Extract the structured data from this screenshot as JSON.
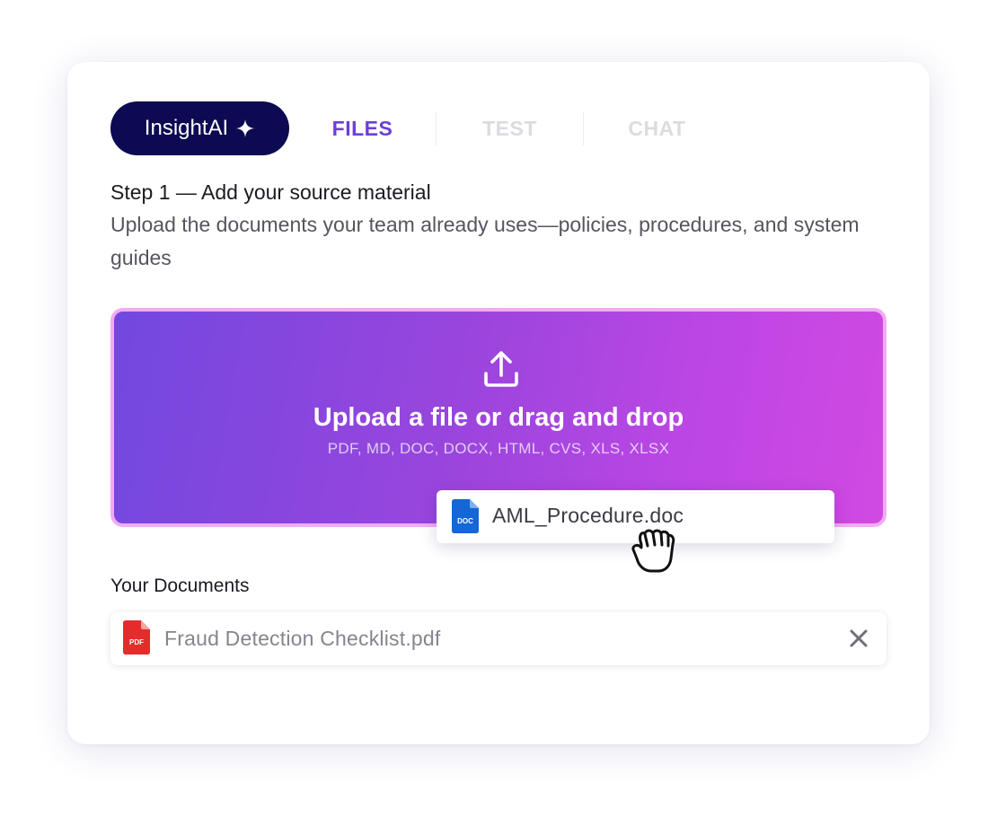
{
  "tabs": {
    "brand_label": "InsightAI",
    "brand_icon": "sparkle-icon",
    "items": [
      {
        "label": "FILES",
        "active": true
      },
      {
        "label": "TEST",
        "active": false
      },
      {
        "label": "CHAT",
        "active": false
      }
    ]
  },
  "step": {
    "title": "Step 1 — Add your source material",
    "description": "Upload the documents your team already uses—policies, procedures, and system guides"
  },
  "upload": {
    "icon": "upload-icon",
    "title": "Upload a file or drag and drop",
    "formats": "PDF, MD, DOC, DOCX, HTML, CVS, XLS, XLSX"
  },
  "dragging_file": {
    "name": "AML_Procedure.doc",
    "type_badge": "DOC",
    "icon": "doc-file-icon",
    "cursor_icon": "grab-hand-icon"
  },
  "documents": {
    "label": "Your Documents",
    "items": [
      {
        "name": "Fraud Detection Checklist.pdf",
        "type_badge": "PDF",
        "icon": "pdf-file-icon",
        "remove_icon": "close-icon"
      }
    ]
  },
  "colors": {
    "brand_navy": "#0c0a52",
    "active_tab": "#6c3fd8",
    "inactive_tab": "#dcdbe1",
    "dropzone_start": "#7248df",
    "dropzone_end": "#d149e3",
    "dropzone_border": "#f2abf2",
    "doc_blue": "#1566d6",
    "pdf_red": "#e52b2b"
  }
}
